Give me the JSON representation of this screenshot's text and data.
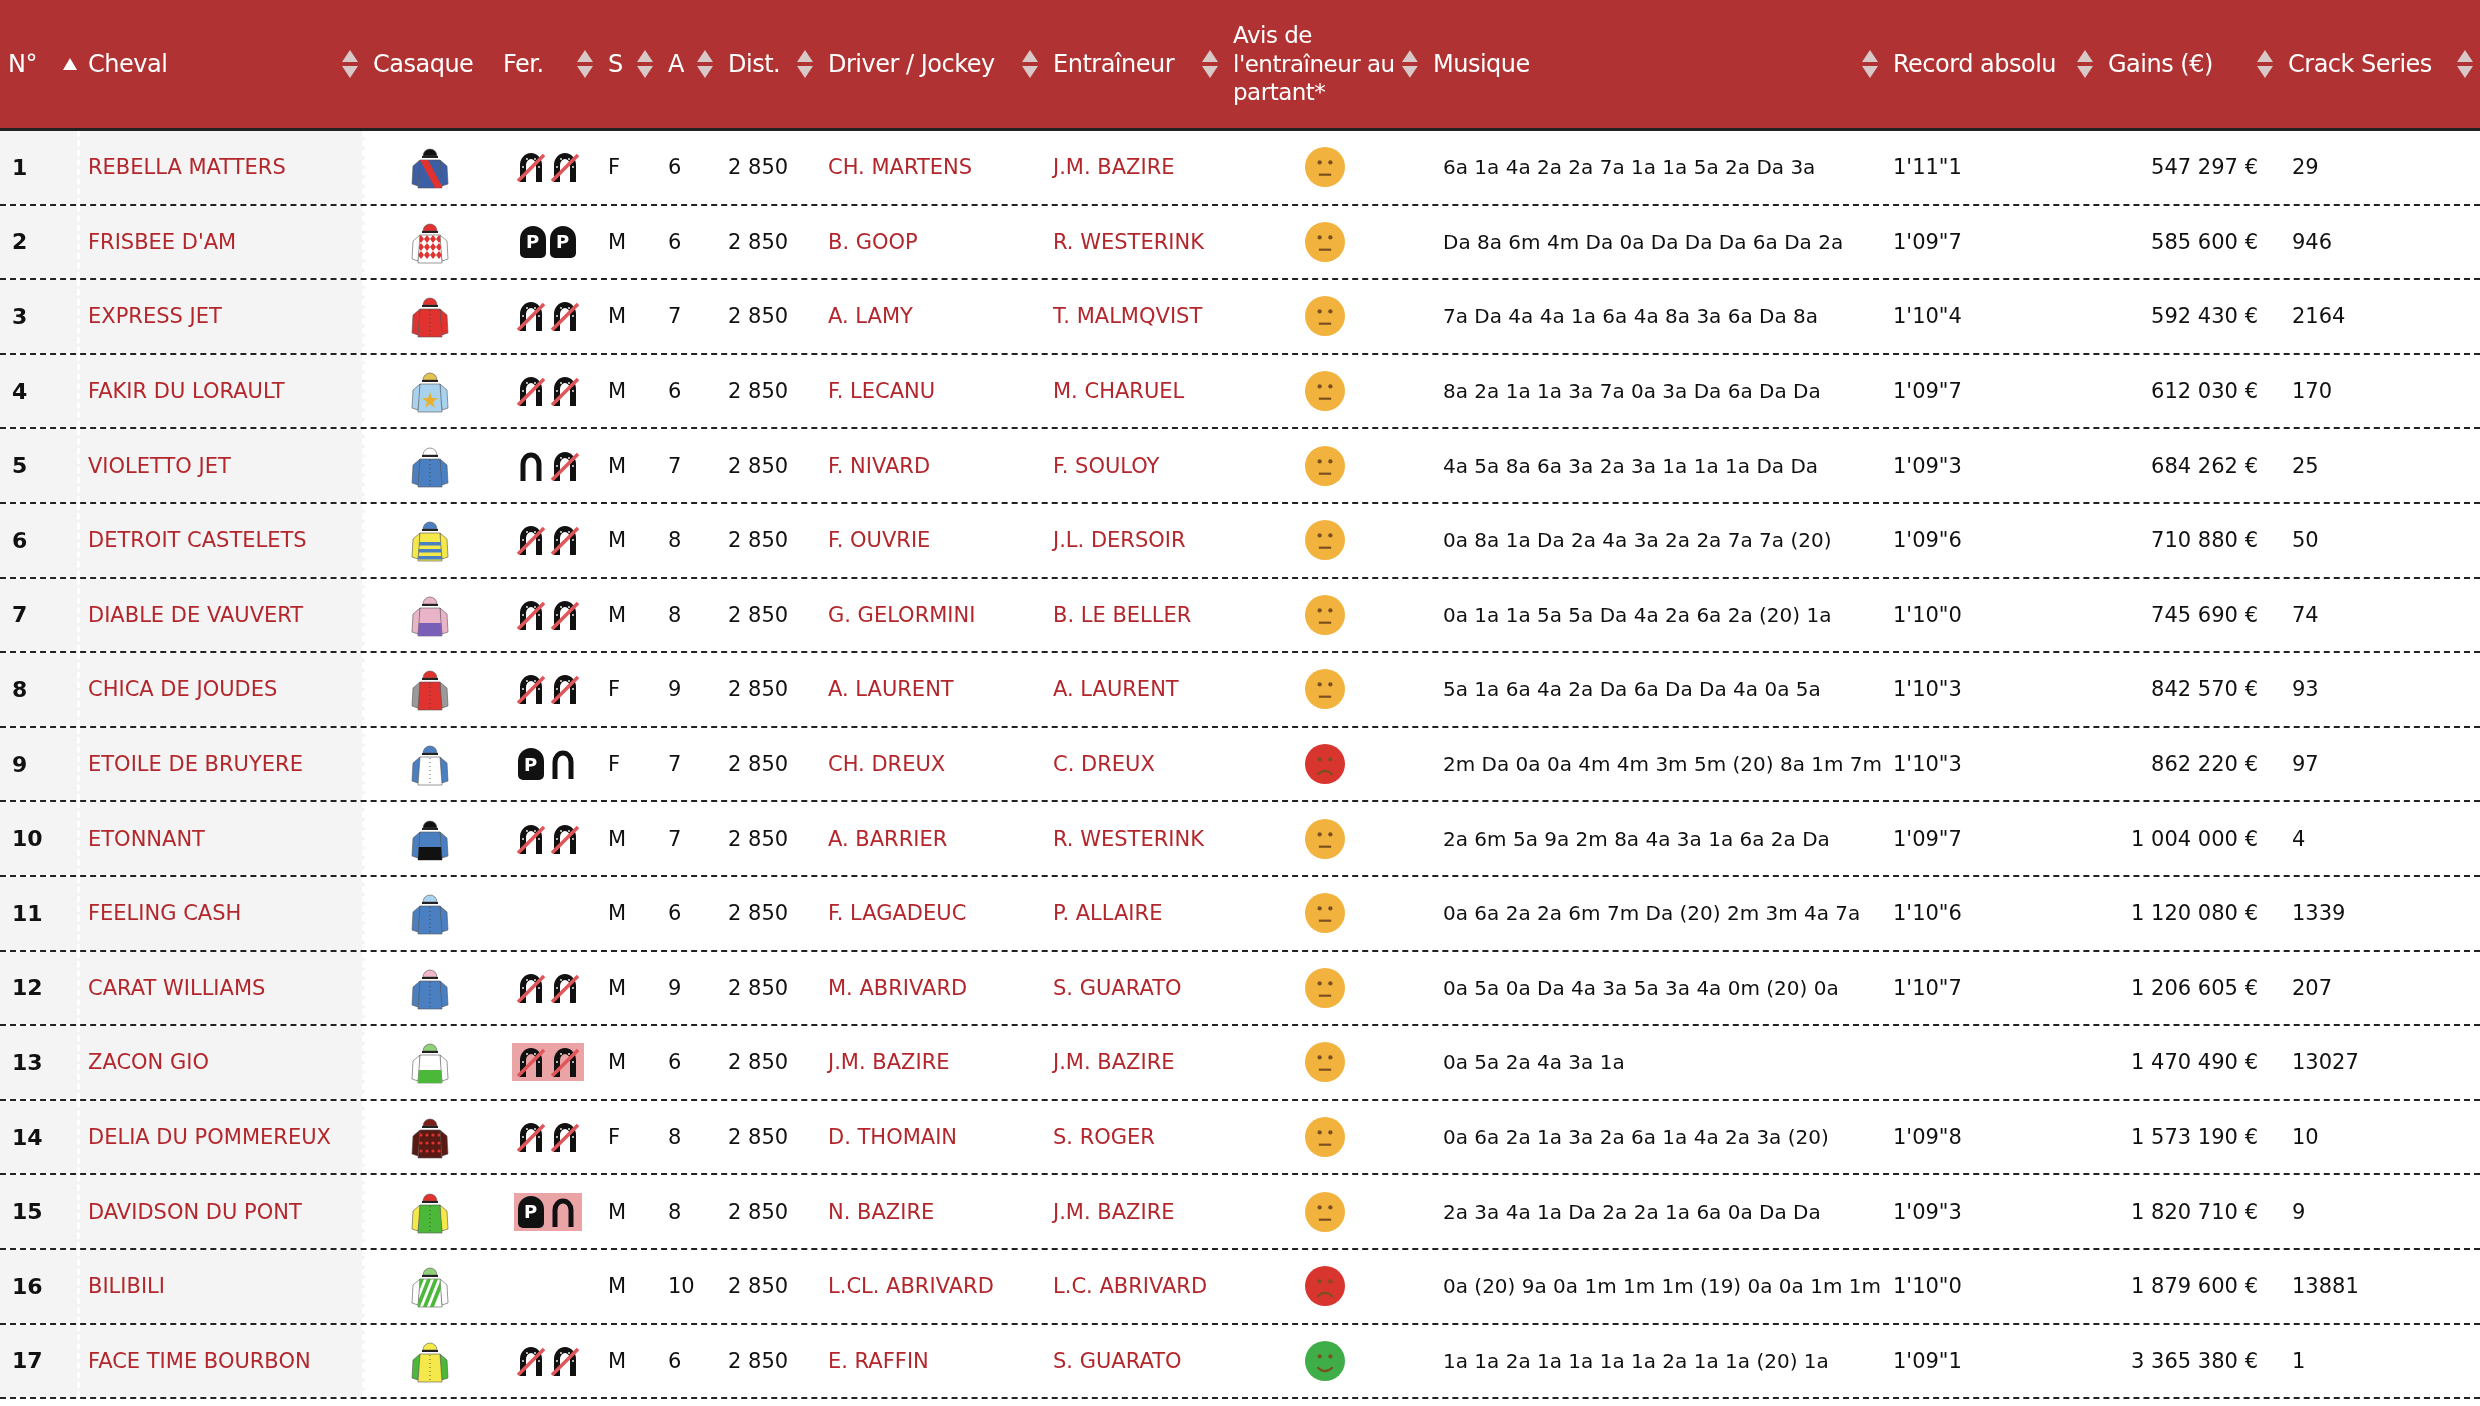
{
  "columns": [
    {
      "label": "N°",
      "sortable": true,
      "sorted": true
    },
    {
      "label": "Cheval",
      "sortable": true,
      "sorted": false
    },
    {
      "label": "Casaque"
    },
    {
      "label": "Fer.",
      "sortable": true,
      "sorted": false
    },
    {
      "label": "S",
      "sortable": true,
      "sorted": false
    },
    {
      "label": "A",
      "sortable": true,
      "sorted": false
    },
    {
      "label": "Dist.",
      "sortable": true,
      "sorted": false
    },
    {
      "label": "Driver / Jockey",
      "sortable": true,
      "sorted": false
    },
    {
      "label": "Entraîneur",
      "sortable": true,
      "sorted": false
    },
    {
      "label": "Avis de l'entraîneur au partant*",
      "sortable": true,
      "sorted": false
    },
    {
      "label": "Musique",
      "sortable": true,
      "sorted": false
    },
    {
      "label": "Record absolu",
      "sortable": true,
      "sorted": false
    },
    {
      "label": "Gains (€)",
      "sortable": true,
      "sorted": false
    },
    {
      "label": "Crack Series",
      "sortable": true,
      "sorted": false
    }
  ],
  "rows": [
    {
      "number": "1",
      "horse": "REBELLA MATTERS",
      "silk": {
        "kind": "sash",
        "color": "#3b5ea6",
        "sleeves": {
          "color": "#3b5ea6"
        },
        "cap": {
          "color": "#111111"
        },
        "accent": {
          "color": "#e0322f"
        }
      },
      "shoes": [
        {
          "kind": "barefoot"
        },
        {
          "kind": "barefoot"
        }
      ],
      "shoes_highlighted": false,
      "sex": "F",
      "age": "6",
      "distance": "2 850",
      "driver": "CH. MARTENS",
      "trainer": "J.M. BAZIRE",
      "opinion": {
        "kind": "neutral"
      },
      "music": "6a 1a 4a 2a 2a 7a 1a 1a 5a 2a Da 3a",
      "record": "1'11\"1",
      "earnings": "547 297 €",
      "crack_series": "29"
    },
    {
      "number": "2",
      "horse": "FRISBEE D'AM",
      "silk": {
        "kind": "diamonds",
        "color": "#ffffff",
        "cap": {
          "color": "#e0322f"
        },
        "accent": {
          "color": "#e0322f"
        }
      },
      "shoes": [
        {
          "kind": "plate",
          "label": "P"
        },
        {
          "kind": "plate",
          "label": "P"
        }
      ],
      "shoes_highlighted": false,
      "sex": "M",
      "age": "6",
      "distance": "2 850",
      "driver": "B. GOOP",
      "trainer": "R. WESTERINK",
      "opinion": {
        "kind": "neutral"
      },
      "music": "Da 8a 6m 4m Da 0a Da Da Da 6a Da 2a",
      "record": "1'09\"7",
      "earnings": "585 600 €",
      "crack_series": "946"
    },
    {
      "number": "3",
      "horse": "EXPRESS JET",
      "silk": {
        "kind": "plain",
        "color": "#e0322f",
        "sleeves": {
          "color": "#e0322f"
        },
        "cap": {
          "color": "#e0322f"
        }
      },
      "shoes": [
        {
          "kind": "barefoot"
        },
        {
          "kind": "barefoot"
        }
      ],
      "shoes_highlighted": false,
      "sex": "M",
      "age": "7",
      "distance": "2 850",
      "driver": "A. LAMY",
      "trainer": "T. MALMQVIST",
      "opinion": {
        "kind": "neutral"
      },
      "music": "7a Da 4a 4a 1a 6a 4a 8a 3a 6a Da 8a",
      "record": "1'10\"4",
      "earnings": "592 430 €",
      "crack_series": "2164"
    },
    {
      "number": "4",
      "horse": "FAKIR DU LORAULT",
      "silk": {
        "kind": "star",
        "color": "#a9d2ef",
        "sleeves": {
          "color": "#a9d2ef"
        },
        "cap": {
          "color": "#e2c250"
        },
        "accent": {
          "color": "#e8b030"
        }
      },
      "shoes": [
        {
          "kind": "barefoot"
        },
        {
          "kind": "barefoot"
        }
      ],
      "shoes_highlighted": false,
      "sex": "M",
      "age": "6",
      "distance": "2 850",
      "driver": "F. LECANU",
      "trainer": "M. CHARUEL",
      "opinion": {
        "kind": "neutral"
      },
      "music": "8a 2a 1a 1a 3a 7a 0a 3a Da 6a Da Da",
      "record": "1'09\"7",
      "earnings": "612 030 €",
      "crack_series": "170"
    },
    {
      "number": "5",
      "horse": "VIOLETTO JET",
      "silk": {
        "kind": "plain",
        "color": "#4a7fc1",
        "sleeves": {
          "color": "#4a7fc1"
        },
        "cap": {
          "color": "#ffffff"
        }
      },
      "shoes": [
        {
          "kind": "shod"
        },
        {
          "kind": "barefoot"
        }
      ],
      "shoes_highlighted": false,
      "sex": "M",
      "age": "7",
      "distance": "2 850",
      "driver": "F. NIVARD",
      "trainer": "F. SOULOY",
      "opinion": {
        "kind": "neutral"
      },
      "music": "4a 5a 8a 6a 3a 2a 3a 1a 1a 1a Da Da",
      "record": "1'09\"3",
      "earnings": "684 262 €",
      "crack_series": "25"
    },
    {
      "number": "6",
      "horse": "DETROIT CASTELETS",
      "silk": {
        "kind": "hoops",
        "color": "#f4e84a",
        "sleeves": {
          "color": "#f4e84a"
        },
        "cap": {
          "color": "#4a7fc1"
        },
        "accent": {
          "color": "#4a7fc1"
        }
      },
      "shoes": [
        {
          "kind": "barefoot"
        },
        {
          "kind": "barefoot"
        }
      ],
      "shoes_highlighted": false,
      "sex": "M",
      "age": "8",
      "distance": "2 850",
      "driver": "F. OUVRIE",
      "trainer": "J.L. DERSOIR",
      "opinion": {
        "kind": "neutral"
      },
      "music": "0a 8a 1a Da 2a 4a 3a 2a 2a 7a 7a (20)",
      "record": "1'09\"6",
      "earnings": "710 880 €",
      "crack_series": "50"
    },
    {
      "number": "7",
      "horse": "DIABLE DE VAUVERT",
      "silk": {
        "kind": "halves",
        "color": "#eab4c8",
        "sleeves": {
          "color": "#eab4c8"
        },
        "cap": {
          "color": "#eab4c8"
        },
        "accent": {
          "color": "#7a5fb8"
        }
      },
      "shoes": [
        {
          "kind": "barefoot"
        },
        {
          "kind": "barefoot"
        }
      ],
      "shoes_highlighted": false,
      "sex": "M",
      "age": "8",
      "distance": "2 850",
      "driver": "G. GELORMINI",
      "trainer": "B. LE BELLER",
      "opinion": {
        "kind": "neutral"
      },
      "music": "0a 1a 1a 5a 5a Da 4a 2a 6a 2a (20) 1a",
      "record": "1'10\"0",
      "earnings": "745 690 €",
      "crack_series": "74"
    },
    {
      "number": "8",
      "horse": "CHICA DE JOUDES",
      "silk": {
        "kind": "plain",
        "color": "#e0322f",
        "sleeves": {
          "color": "#9a9a9a"
        },
        "cap": {
          "color": "#e0322f"
        }
      },
      "shoes": [
        {
          "kind": "barefoot"
        },
        {
          "kind": "barefoot"
        }
      ],
      "shoes_highlighted": false,
      "sex": "F",
      "age": "9",
      "distance": "2 850",
      "driver": "A. LAURENT",
      "trainer": "A. LAURENT",
      "opinion": {
        "kind": "neutral"
      },
      "music": "5a 1a 6a 4a 2a Da 6a Da Da 4a 0a 5a",
      "record": "1'10\"3",
      "earnings": "842 570 €",
      "crack_series": "93"
    },
    {
      "number": "9",
      "horse": "ETOILE DE BRUYERE",
      "silk": {
        "kind": "plain",
        "color": "#ffffff",
        "sleeves": {
          "color": "#4a7fc1"
        },
        "cap": {
          "color": "#4a7fc1"
        }
      },
      "shoes": [
        {
          "kind": "plate",
          "label": "P"
        },
        {
          "kind": "shod"
        }
      ],
      "shoes_highlighted": false,
      "sex": "F",
      "age": "7",
      "distance": "2 850",
      "driver": "CH. DREUX",
      "trainer": "C. DREUX",
      "opinion": {
        "kind": "unhappy"
      },
      "music": "2m Da 0a 0a 4m 4m 3m 5m (20) 8a 1m 7m",
      "record": "1'10\"3",
      "earnings": "862 220 €",
      "crack_series": "97"
    },
    {
      "number": "10",
      "horse": "ETONNANT",
      "silk": {
        "kind": "halves",
        "color": "#4a7fc1",
        "sleeves": {
          "color": "#4a7fc1"
        },
        "cap": {
          "color": "#111111"
        },
        "accent": {
          "color": "#111111"
        }
      },
      "shoes": [
        {
          "kind": "barefoot"
        },
        {
          "kind": "barefoot"
        }
      ],
      "shoes_highlighted": false,
      "sex": "M",
      "age": "7",
      "distance": "2 850",
      "driver": "A. BARRIER",
      "trainer": "R. WESTERINK",
      "opinion": {
        "kind": "neutral"
      },
      "music": "2a 6m 5a 9a 2m 8a 4a 3a 1a 6a 2a Da",
      "record": "1'09\"7",
      "earnings": "1 004 000 €",
      "crack_series": "4"
    },
    {
      "number": "11",
      "horse": "FEELING CASH",
      "silk": {
        "kind": "plain",
        "color": "#4a7fc1",
        "sleeves": {
          "color": "#4a7fc1"
        },
        "cap": {
          "color": "#a9d2ef"
        }
      },
      "sex": "M",
      "age": "6",
      "distance": "2 850",
      "driver": "F. LAGADEUC",
      "trainer": "P. ALLAIRE",
      "opinion": {
        "kind": "neutral"
      },
      "music": "0a 6a 2a 2a 6m 7m Da (20) 2m 3m 4a 7a",
      "record": "1'10\"6",
      "earnings": "1 120 080 €",
      "crack_series": "1339"
    },
    {
      "number": "12",
      "horse": "CARAT WILLIAMS",
      "silk": {
        "kind": "plain",
        "color": "#4a7fc1",
        "sleeves": {
          "color": "#4a7fc1"
        },
        "cap": {
          "color": "#f0b8c8"
        }
      },
      "shoes": [
        {
          "kind": "barefoot"
        },
        {
          "kind": "barefoot"
        }
      ],
      "shoes_highlighted": false,
      "sex": "M",
      "age": "9",
      "distance": "2 850",
      "driver": "M. ABRIVARD",
      "trainer": "S. GUARATO",
      "opinion": {
        "kind": "neutral"
      },
      "music": "0a 5a 0a Da 4a 3a 5a 3a 4a 0m (20) 0a",
      "record": "1'10\"7",
      "earnings": "1 206 605 €",
      "crack_series": "207"
    },
    {
      "number": "13",
      "horse": "ZACON GIO",
      "silk": {
        "kind": "halves",
        "color": "#ffffff",
        "cap": {
          "color": "#8fd07a"
        },
        "accent": {
          "color": "#4cb83a"
        }
      },
      "shoes": [
        {
          "kind": "barefoot"
        },
        {
          "kind": "barefoot"
        }
      ],
      "shoes_highlighted": true,
      "sex": "M",
      "age": "6",
      "distance": "2 850",
      "driver": "J.M. BAZIRE",
      "trainer": "J.M. BAZIRE",
      "opinion": {
        "kind": "neutral"
      },
      "music": "0a 5a 2a 4a 3a 1a",
      "earnings": "1 470 490 €",
      "crack_series": "13027"
    },
    {
      "number": "14",
      "horse": "DELIA DU POMMEREUX",
      "silk": {
        "kind": "dots",
        "color": "#5a1a14",
        "sleeves": {
          "color": "#5a1a14"
        },
        "cap": {
          "color": "#7a2018"
        },
        "accent": {
          "color": "#e0322f"
        }
      },
      "shoes": [
        {
          "kind": "barefoot"
        },
        {
          "kind": "barefoot"
        }
      ],
      "shoes_highlighted": false,
      "sex": "F",
      "age": "8",
      "distance": "2 850",
      "driver": "D. THOMAIN",
      "trainer": "S. ROGER",
      "opinion": {
        "kind": "neutral"
      },
      "music": "0a 6a 2a 1a 3a 2a 6a 1a 4a 2a 3a (20)",
      "record": "1'09\"8",
      "earnings": "1 573 190 €",
      "crack_series": "10"
    },
    {
      "number": "15",
      "horse": "DAVIDSON DU PONT",
      "silk": {
        "kind": "plain",
        "color": "#4cb83a",
        "sleeves": {
          "color": "#f4e84a"
        },
        "cap": {
          "color": "#e0322f"
        }
      },
      "shoes": [
        {
          "kind": "plate",
          "label": "P"
        },
        {
          "kind": "shod"
        }
      ],
      "shoes_highlighted": true,
      "sex": "M",
      "age": "8",
      "distance": "2 850",
      "driver": "N. BAZIRE",
      "trainer": "J.M. BAZIRE",
      "opinion": {
        "kind": "neutral"
      },
      "music": "2a 3a 4a 1a Da 2a 2a 1a 6a 0a Da Da",
      "record": "1'09\"3",
      "earnings": "1 820 710 €",
      "crack_series": "9"
    },
    {
      "number": "16",
      "horse": "BILIBILI",
      "silk": {
        "kind": "stripes",
        "color": "#ffffff",
        "cap": {
          "color": "#8fd07a"
        },
        "accent": {
          "color": "#4cb83a"
        }
      },
      "sex": "M",
      "age": "10",
      "distance": "2 850",
      "driver": "L.CL. ABRIVARD",
      "trainer": "L.C. ABRIVARD",
      "opinion": {
        "kind": "unhappy"
      },
      "music": "0a (20) 9a 0a 1m 1m 1m (19) 0a 0a 1m 1m",
      "record": "1'10\"0",
      "earnings": "1 879 600 €",
      "crack_series": "13881"
    },
    {
      "number": "17",
      "horse": "FACE TIME BOURBON",
      "silk": {
        "kind": "plain",
        "color": "#f4e84a",
        "sleeves": {
          "color": "#4cb83a"
        },
        "cap": {
          "color": "#f4e84a"
        }
      },
      "shoes": [
        {
          "kind": "barefoot"
        },
        {
          "kind": "barefoot"
        }
      ],
      "shoes_highlighted": false,
      "sex": "M",
      "age": "6",
      "distance": "2 850",
      "driver": "E. RAFFIN",
      "trainer": "S. GUARATO",
      "opinion": {
        "kind": "happy"
      },
      "music": "1a 1a 2a 1a 1a 1a 1a 2a 1a 1a (20) 1a",
      "record": "1'09\"1",
      "earnings": "3 365 380 €",
      "crack_series": "1"
    }
  ]
}
